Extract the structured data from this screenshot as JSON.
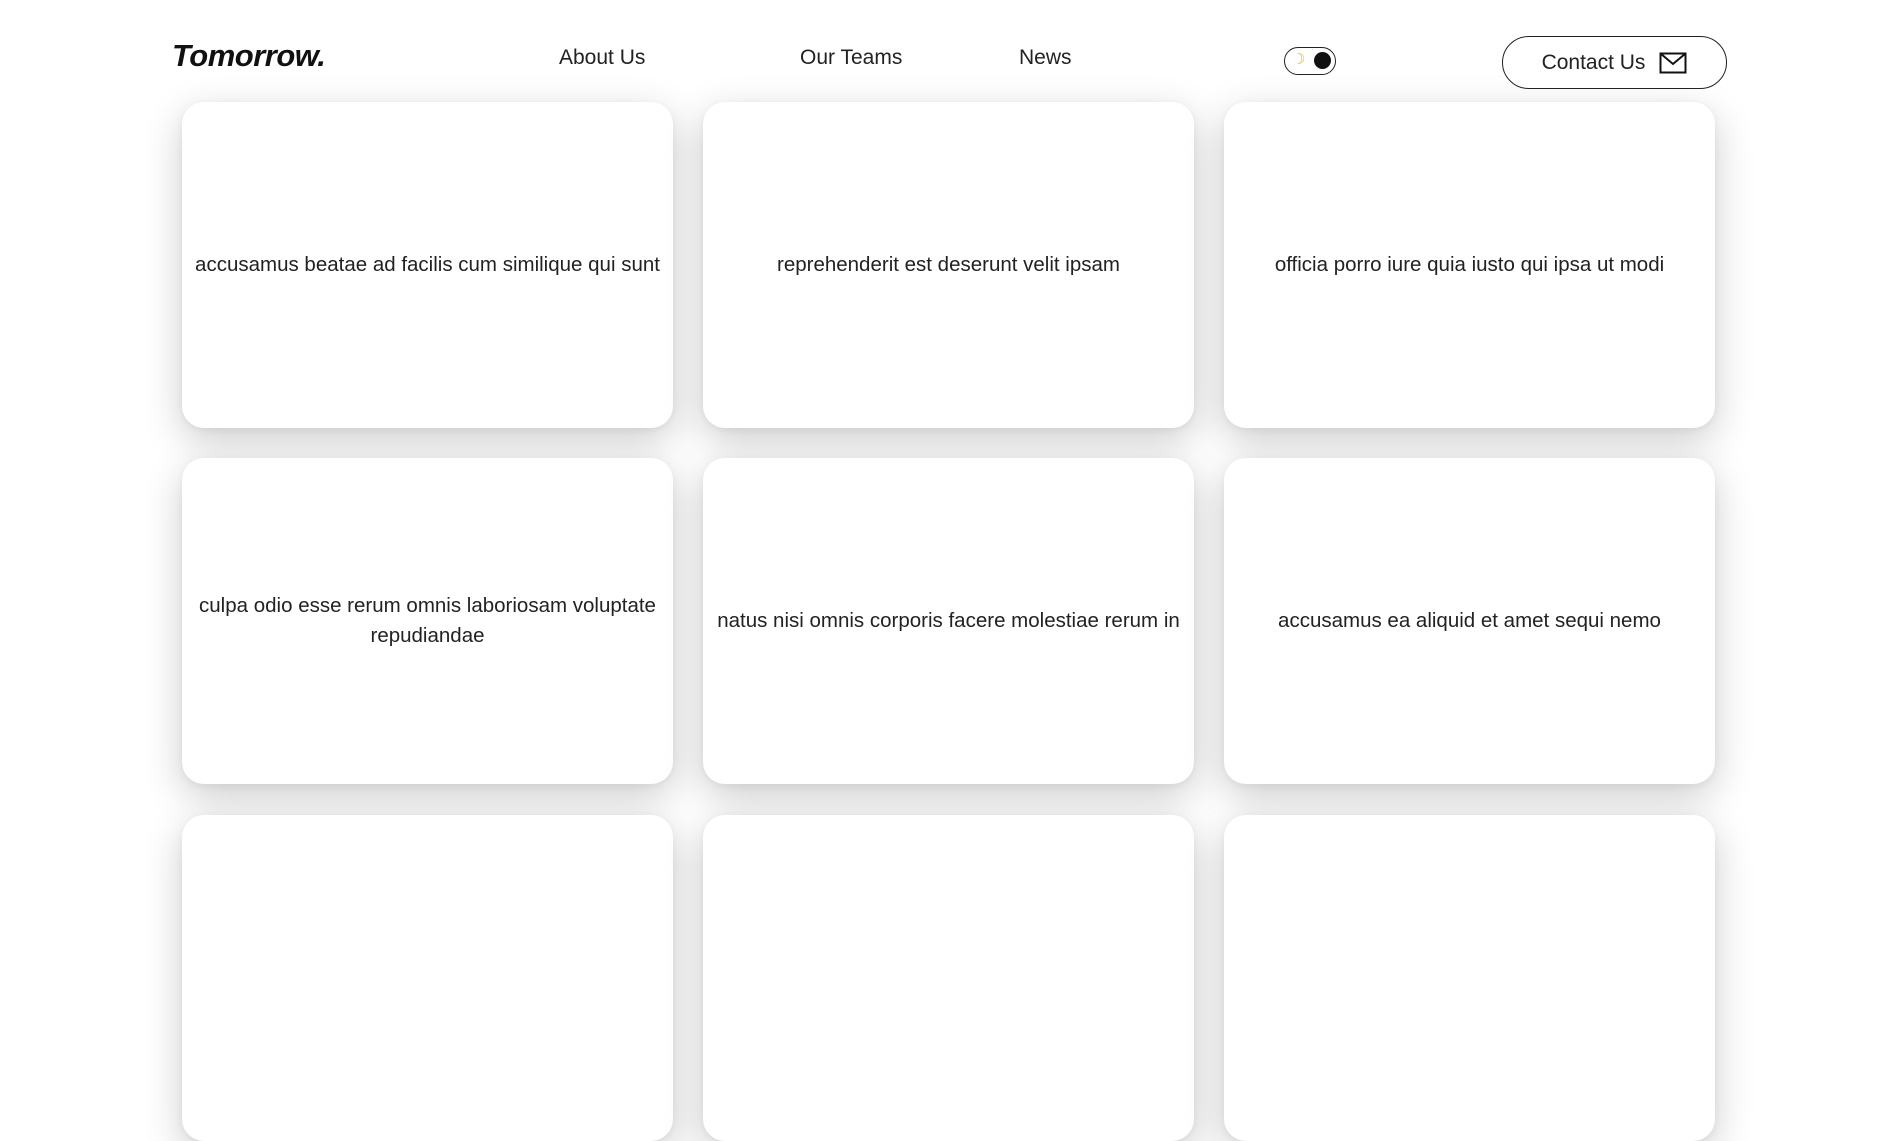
{
  "header": {
    "logo": "Tomorrow.",
    "nav": [
      {
        "label": "About Us"
      },
      {
        "label": "Our Teams"
      },
      {
        "label": "News"
      }
    ],
    "theme_toggle": {
      "icon": "moon-icon",
      "state": "dark"
    },
    "contact_button": {
      "label": "Contact Us",
      "icon": "mail-icon"
    }
  },
  "cards": [
    {
      "text": "accusamus beatae ad facilis cum similique qui sunt"
    },
    {
      "text": "reprehenderit est deserunt velit ipsam"
    },
    {
      "text": "officia porro iure quia iusto qui ipsa ut modi"
    },
    {
      "text": "culpa odio esse rerum omnis laboriosam voluptate repudiandae"
    },
    {
      "text": "natus nisi omnis corporis facere molestiae rerum in"
    },
    {
      "text": "accusamus ea aliquid et amet sequi nemo"
    },
    {
      "text": ""
    },
    {
      "text": ""
    },
    {
      "text": ""
    }
  ],
  "colors": {
    "background": "#ffffff",
    "text": "#222222",
    "moon_accent": "#f2b705"
  }
}
